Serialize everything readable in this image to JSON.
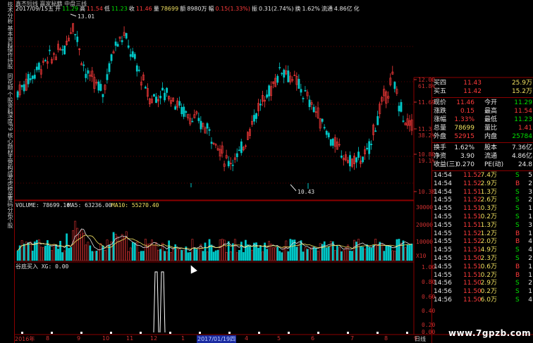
{
  "window": {
    "title": "鑫杰短线 赢家秘籍 中盘三线"
  },
  "header": {
    "line1": "鑫杰短线 赢家秘籍 中盘三线",
    "date": "2017/09/15五",
    "open_label": "开",
    "open": "11.29",
    "high_label": "高",
    "high": "11.54",
    "low_label": "低",
    "low": "11.23",
    "close_label": "收",
    "close": "11.46",
    "vol_label": "量",
    "volume": "78699",
    "amount_label": "额",
    "amount": "8980万",
    "change_label": "幅",
    "change": "0.15(1.33%)",
    "amp_label": "振",
    "amplitude": "0.31(2.74%)",
    "turnover_label": "换",
    "turnover": "1.62%",
    "float_label": "流通",
    "float": "4.86亿",
    "tail": "化"
  },
  "left_tabs": [
    "技术分析",
    "基本资料",
    "操作持股",
    "同花顺",
    "个股资料",
    "深度F9",
    "核心题材",
    "主营构成",
    "龙虎榜单",
    "筹码分布",
    "个股"
  ],
  "price_chart": {
    "high_label": "13.01",
    "low_label": "10.43",
    "axis_right": [
      {
        "price": "12.00",
        "pct": "61.8%"
      },
      {
        "price": "11.69",
        "pct": ""
      },
      {
        "price": "11.3",
        "pct": "38.2%"
      },
      {
        "price": "10.80",
        "pct": "19.1%"
      },
      {
        "price": "10.38",
        "pct": ""
      }
    ],
    "ylim": [
      10.2,
      13.2
    ]
  },
  "volume_panel": {
    "volume_label": "VOLUME: 78699.16",
    "ma5_label": "MA5: 63236.00",
    "ma10_label": "MA10: 55270.40",
    "axis": [
      "30000",
      "20000",
      "10000",
      "X10"
    ]
  },
  "indicator_panel": {
    "label": "谷底买入  XG: 0.00",
    "axis": [
      "1.00",
      "0.80",
      "0.60",
      "0.40",
      "0.20",
      "0.00"
    ]
  },
  "bottom_axis": {
    "labels": [
      "2016年",
      "8",
      "9",
      "10",
      "11",
      "12",
      "1",
      "2017/01/19四",
      "4",
      "5",
      "6",
      "7",
      "8",
      "9"
    ],
    "period_button": "日线"
  },
  "quote": {
    "ask4_label": "买四",
    "ask4_price": "11.43",
    "ask4_vol": "25.9万",
    "ask5_label": "买五",
    "ask5_price": "11.42",
    "ask5_vol": "15.2万",
    "now_label": "现价",
    "now": "11.46",
    "open_label": "今开",
    "open": "11.29",
    "chg_label": "涨跌",
    "chg": "0.15",
    "high_label": "最高",
    "high": "11.54",
    "pct_label": "涨幅",
    "pct": "1.33%",
    "low_label": "最低",
    "low": "11.23",
    "total_label": "总量",
    "total": "78699",
    "vr_label": "量比",
    "vr": "1.41",
    "out_label": "外盘",
    "out": "52915",
    "in_label": "内盘",
    "in": "25784",
    "turn_label": "换手",
    "turn": "1.62%",
    "cap_label": "股本",
    "cap": "7.36亿",
    "nav_label": "净资",
    "nav": "3.90",
    "flt_label": "流通",
    "flt": "4.86亿",
    "eps_label": "收益(三)",
    "eps": "0.270",
    "pe_label": "PE(动)",
    "pe": "24.8"
  },
  "ticks": [
    {
      "t": "14:54",
      "p": "11.52",
      "v": "7.4万",
      "s": "S",
      "n": "5"
    },
    {
      "t": "14:54",
      "p": "11.52",
      "v": "2.9万",
      "s": "B",
      "n": "2"
    },
    {
      "t": "14:54",
      "p": "11.51",
      "v": "1.3万",
      "s": "S",
      "n": "3"
    },
    {
      "t": "14:55",
      "p": "11.52",
      "v": "2.6万",
      "s": "S",
      "n": "2"
    },
    {
      "t": "14:55",
      "p": "11.51",
      "v": "0.3万",
      "s": "S",
      "n": "1"
    },
    {
      "t": "14:55",
      "p": "11.51",
      "v": "0.2万",
      "s": "S",
      "n": "1"
    },
    {
      "t": "14:55",
      "p": "11.51",
      "v": "1.3万",
      "s": "S",
      "n": "3"
    },
    {
      "t": "14:55",
      "p": "11.52",
      "v": "1.2万",
      "s": "B",
      "n": "1"
    },
    {
      "t": "14:55",
      "p": "11.52",
      "v": "2.0万",
      "s": "B",
      "n": "4"
    },
    {
      "t": "14:55",
      "p": "11.51",
      "v": "4.9万",
      "s": "S",
      "n": "4"
    },
    {
      "t": "14:55",
      "p": "11.50",
      "v": "2.3万",
      "s": "S",
      "n": "2"
    },
    {
      "t": "14:55",
      "p": "11.51",
      "v": "0.6万",
      "s": "B",
      "n": "1"
    },
    {
      "t": "14:55",
      "p": "11.51",
      "v": "0.2万",
      "s": "B",
      "n": "1"
    },
    {
      "t": "14:56",
      "p": "11.50",
      "v": "2.9万",
      "s": "S",
      "n": "2"
    },
    {
      "t": "14:56",
      "p": "11.50",
      "v": "0.2万",
      "s": "S",
      "n": "1"
    },
    {
      "t": "14:56",
      "p": "11.50",
      "v": "6.0万",
      "s": "S",
      "n": "4"
    }
  ],
  "watermark": "www.7gpzb.com",
  "colors": {
    "up": "#ff3b3b",
    "down": "#00c0c0",
    "axis": "#8b0000",
    "bg": "#000000"
  }
}
